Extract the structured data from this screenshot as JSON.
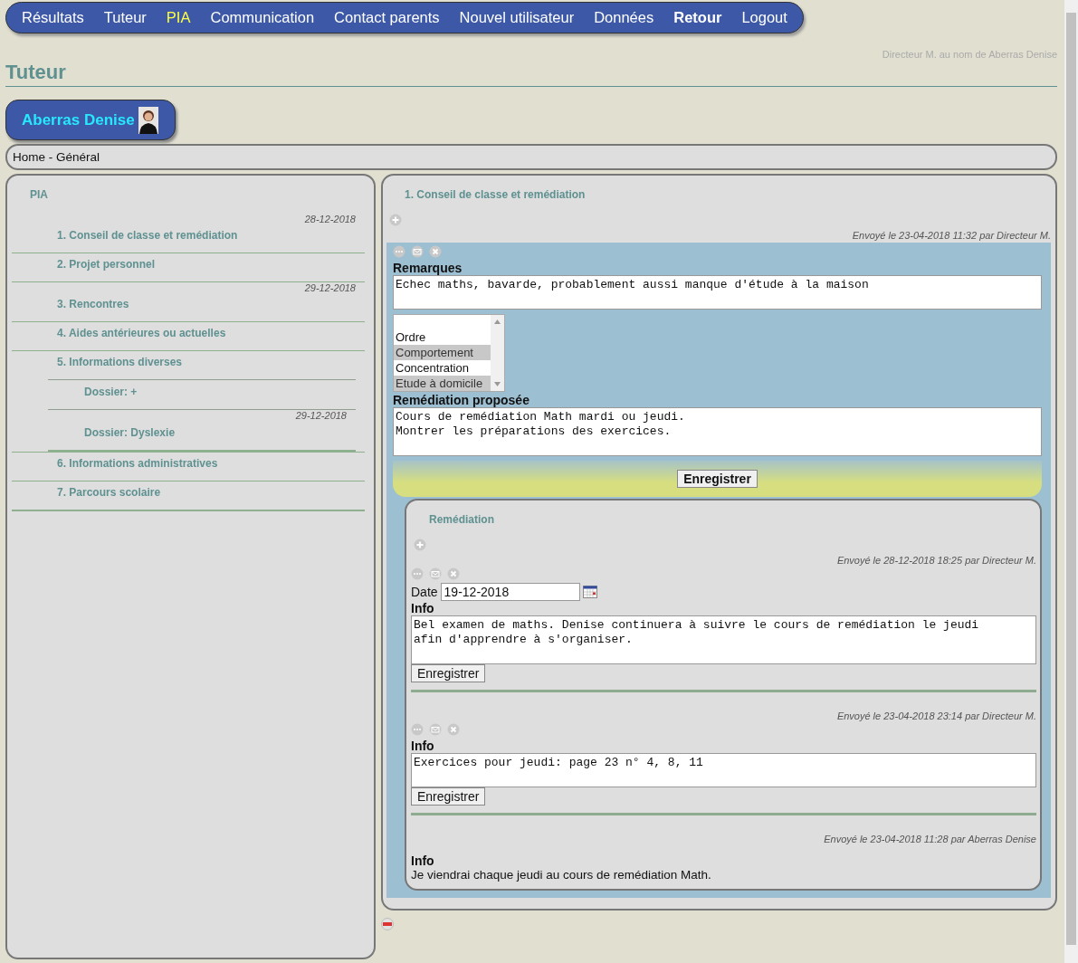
{
  "nav": [
    {
      "label": "Résultats",
      "selected": false,
      "bold": false
    },
    {
      "label": "Tuteur",
      "selected": false,
      "bold": false
    },
    {
      "label": "PIA",
      "selected": true,
      "bold": false
    },
    {
      "label": "Communication",
      "selected": false,
      "bold": false
    },
    {
      "label": "Contact parents",
      "selected": false,
      "bold": false
    },
    {
      "label": "Nouvel utilisateur",
      "selected": false,
      "bold": false
    },
    {
      "label": "Données",
      "selected": false,
      "bold": false
    },
    {
      "label": "Retour",
      "selected": false,
      "bold": true
    },
    {
      "label": "Logout",
      "selected": false,
      "bold": false
    }
  ],
  "user_note": "Directeur M. au nom de Aberras Denise",
  "page_title": "Tuteur",
  "student": {
    "name": "Aberras Denise"
  },
  "breadcrumb": "Home - Général",
  "sidebar": {
    "title": "PIA",
    "items": [
      {
        "label": "1. Conseil de classe et remédiation",
        "date": "28-12-2018"
      },
      {
        "label": "2. Projet personnel"
      },
      {
        "label": "3. Rencontres",
        "date": "29-12-2018"
      },
      {
        "label": "4. Aides antérieures ou actuelles"
      },
      {
        "label": "5. Informations diverses",
        "children": [
          {
            "label": "Dossier: +"
          },
          {
            "label": "Dossier: Dyslexie",
            "date": "29-12-2018"
          }
        ]
      },
      {
        "label": "6. Informations administratives"
      },
      {
        "label": "7. Parcours scolaire"
      }
    ]
  },
  "section": {
    "title": "1. Conseil de classe et remédiation",
    "sent": "Envoyé le 23-04-2018 11:32 par Directeur M.",
    "remarks_label": "Remarques",
    "remarks": "Echec maths, bavarde, probablement aussi manque d'étude à la maison",
    "options": [
      {
        "label": "Ordre",
        "selected": false
      },
      {
        "label": "Comportement",
        "selected": true
      },
      {
        "label": "Concentration",
        "selected": false
      },
      {
        "label": "Etude à domicile",
        "selected": true
      }
    ],
    "remediation_label": "Remédiation proposée",
    "remediation": "Cours de remédiation Math mardi ou jeudi.\nMontrer les préparations des exercices.",
    "save": "Enregistrer",
    "sub": {
      "title": "Remédiation",
      "entries": [
        {
          "kind": "editable",
          "sent": "Envoyé le 28-12-2018 18:25 par Directeur M.",
          "date_label": "Date",
          "date": "19-12-2018",
          "info_label": "Info",
          "info": "Bel examen de maths. Denise continuera à suivre le cours de remédiation le jeudi\nafin d'apprendre à s'organiser.",
          "button": "Enregistrer"
        },
        {
          "kind": "editable",
          "sent": "Envoyé le 23-04-2018 23:14 par Directeur M.",
          "info_label": "Info",
          "info": "Exercices pour jeudi: page 23 n° 4, 8, 11",
          "button": "Enregistrer"
        },
        {
          "kind": "readonly",
          "sent": "Envoyé le 23-04-2018 11:28 par Aberras Denise",
          "info_label": "Info",
          "info": "Je viendrai chaque jeudi au cours de remédiation Math."
        }
      ]
    }
  }
}
